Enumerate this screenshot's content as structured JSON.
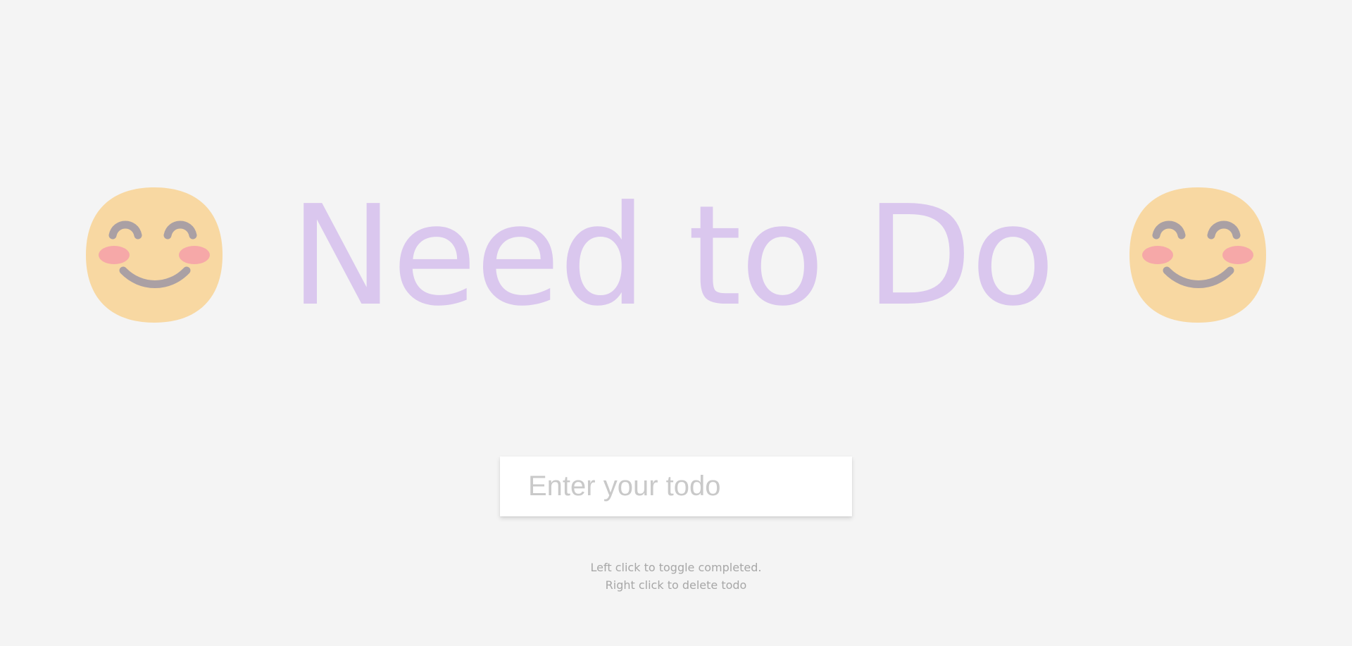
{
  "header": {
    "title": "Need to Do",
    "left_icon": "smiling-face-icon",
    "right_icon": "smiling-face-icon"
  },
  "todo_input": {
    "placeholder": "Enter your todo",
    "value": ""
  },
  "instructions": {
    "line1": "Left click to toggle completed.",
    "line2": "Right click to delete todo"
  },
  "colors": {
    "background": "#f4f4f4",
    "title": "#dac7ee",
    "emoji_face": "#f8d8a2",
    "emoji_features": "#aaa0a4",
    "emoji_cheeks": "#f6a8a8",
    "hint_text": "#a7a7a7"
  }
}
